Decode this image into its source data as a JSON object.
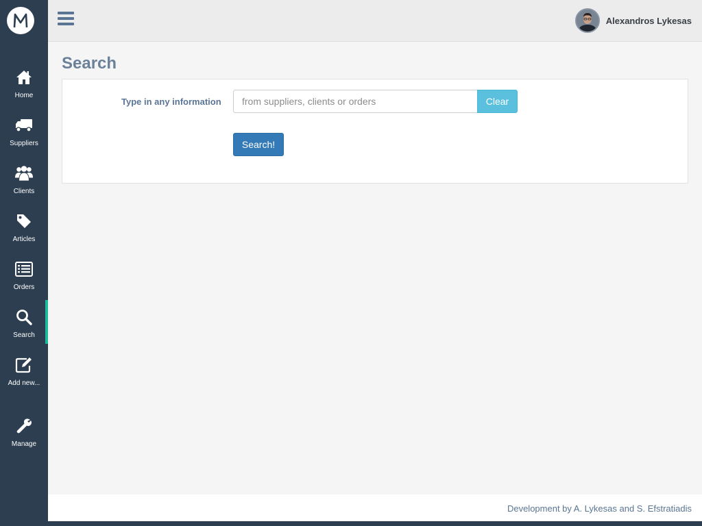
{
  "brand": {
    "logo_letter": "M"
  },
  "sidebar": {
    "items": [
      {
        "label": "Home",
        "icon": "home-icon"
      },
      {
        "label": "Suppliers",
        "icon": "truck-icon"
      },
      {
        "label": "Clients",
        "icon": "users-icon"
      },
      {
        "label": "Articles",
        "icon": "tag-icon"
      },
      {
        "label": "Orders",
        "icon": "list-icon"
      },
      {
        "label": "Search",
        "icon": "search-icon",
        "active": true
      },
      {
        "label": "Add new...",
        "icon": "edit-icon"
      },
      {
        "label": "Manage",
        "icon": "wrench-icon"
      }
    ],
    "accent_color": "#1abc9c"
  },
  "header": {
    "menu_icon": "hamburger-icon",
    "user_name": "Alexandros Lykesas"
  },
  "main": {
    "title": "Search",
    "form": {
      "label": "Type in any information",
      "input_placeholder": "from suppliers, clients or orders",
      "input_value": "",
      "clear_label": "Clear",
      "submit_label": "Search!"
    }
  },
  "footer": {
    "credit": "Development by A. Lykesas and S. Efstratiadis"
  },
  "colors": {
    "sidebar": "#2c3e50",
    "primary": "#337ab7",
    "info": "#5bc0de",
    "title": "#6b8099"
  }
}
